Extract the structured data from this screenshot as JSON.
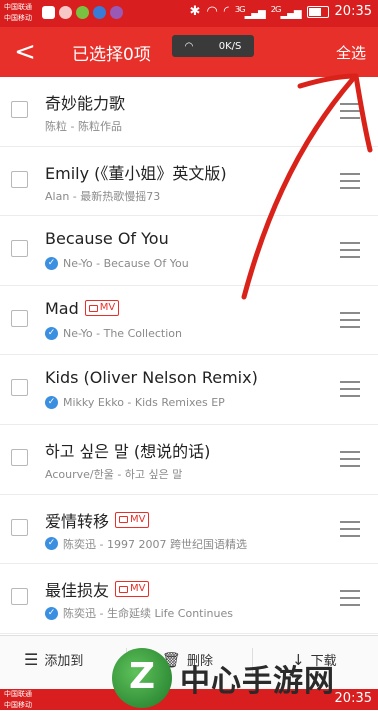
{
  "status_bar": {
    "carrier1": "中国联通",
    "carrier2": "中国移动",
    "net1": "3G",
    "net2": "2G",
    "time": "20:35"
  },
  "toolbar": {
    "back_icon": "chevron-left",
    "title": "已选择0项",
    "net_speed": "0K/S",
    "select_all": "全选"
  },
  "songs": [
    {
      "title": "奇妙能力歌",
      "subtitle": "陈粒 - 陈粒作品",
      "verified": false,
      "mv": false
    },
    {
      "title": "Emily (《董小姐》英文版)",
      "subtitle": "Alan - 最新热歌慢摇73",
      "verified": false,
      "mv": false
    },
    {
      "title": "Because Of You",
      "subtitle": "Ne-Yo - Because Of You",
      "verified": true,
      "mv": false
    },
    {
      "title": "Mad",
      "subtitle": "Ne-Yo - The Collection",
      "verified": true,
      "mv": true
    },
    {
      "title": "Kids (Oliver Nelson Remix)",
      "subtitle": "Mikky Ekko - Kids Remixes EP",
      "verified": true,
      "mv": false
    },
    {
      "title": "하고 싶은 말 (想说的话)",
      "subtitle": "Acourve/한울 - 하고 싶은 말",
      "verified": false,
      "mv": false
    },
    {
      "title": "爱情转移",
      "subtitle": "陈奕迅 - 1997 2007 跨世纪国语精选",
      "verified": true,
      "mv": true
    },
    {
      "title": "最佳损友",
      "subtitle": "陈奕迅 - 生命延续 Life Continues",
      "verified": true,
      "mv": true
    }
  ],
  "mv_label": "MV",
  "bottom_bar": {
    "add_to": "添加到",
    "delete": "删除",
    "download": "下载"
  },
  "watermark": {
    "logo_letter": "Z",
    "text": "中心手游网"
  },
  "colors": {
    "accent": "#e8302a",
    "status_bar": "#d81e1e",
    "verified": "#3b8fe0"
  }
}
